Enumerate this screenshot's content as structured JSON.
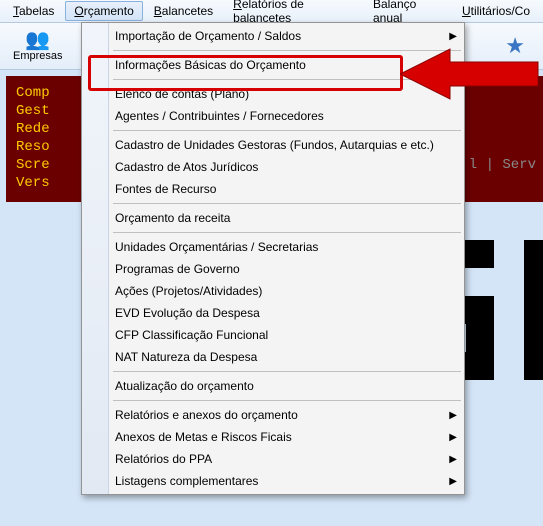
{
  "menubar": {
    "items": [
      {
        "u": "T",
        "rest": "abelas"
      },
      {
        "u": "O",
        "rest": "rçamento"
      },
      {
        "u": "B",
        "rest": "alancetes"
      },
      {
        "u": "R",
        "rest": "elatórios de balancetes"
      },
      {
        "label_full": "Balanço anual",
        "u": "a",
        "pre": "Balanço ",
        "post": "nual"
      },
      {
        "u": "U",
        "rest": "tilitários/Co"
      }
    ]
  },
  "toolbar": {
    "empresas": {
      "label": "Empresas",
      "icon": "👥"
    },
    "star": "★"
  },
  "dark_panel": {
    "lines": [
      "Comp",
      "Gest",
      "Rede",
      "Reso",
      "Scre",
      "Vers"
    ],
    "tail": "l | Serv"
  },
  "menu": {
    "items": [
      {
        "label": "Importação de Orçamento / Saldos",
        "sub": true
      },
      {
        "sep": true
      },
      {
        "label": "Informações Básicas do Orçamento",
        "highlight": true
      },
      {
        "sep": true
      },
      {
        "label": "Elenco de contas (Plano)"
      },
      {
        "label": "Agentes / Contribuintes / Fornecedores"
      },
      {
        "sep": true
      },
      {
        "label": "Cadastro de Unidades Gestoras (Fundos, Autarquias e etc.)"
      },
      {
        "label": "Cadastro de Atos Jurídicos"
      },
      {
        "label": "Fontes de Recurso"
      },
      {
        "sep": true
      },
      {
        "label": "Orçamento da receita"
      },
      {
        "sep": true
      },
      {
        "label": "Unidades Orçamentárias / Secretarias"
      },
      {
        "label": "Programas de Governo"
      },
      {
        "label": "Ações (Projetos/Atividades)"
      },
      {
        "label": "EVD Evolução da Despesa"
      },
      {
        "label": "CFP Classificação Funcional"
      },
      {
        "label": "NAT Natureza da Despesa"
      },
      {
        "sep": true
      },
      {
        "label": "Atualização do orçamento"
      },
      {
        "sep": true
      },
      {
        "label": "Relatórios e anexos do orçamento",
        "sub": true
      },
      {
        "label": "Anexos de Metas e Riscos Ficais",
        "sub": true
      },
      {
        "label": "Relatórios do PPA",
        "sub": true
      },
      {
        "label": "Listagens complementares",
        "sub": true
      }
    ]
  }
}
